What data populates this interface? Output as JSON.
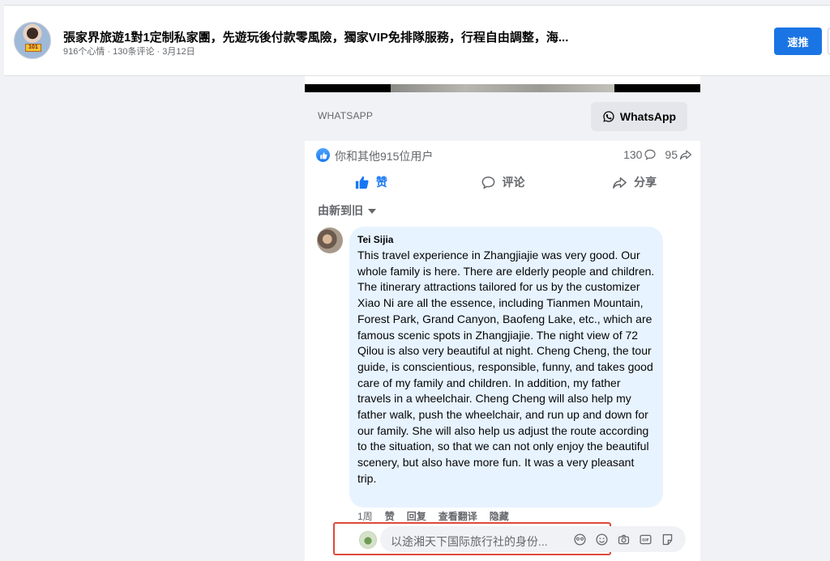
{
  "header": {
    "title": "張家界旅遊1對1定制私家團，先遊玩後付款零風險，獨家VIP免排隊服務，行程自由調整，海...",
    "meta": "916个心情 · 130条评论 · 3月12日",
    "boost_label": "速推",
    "avatar_sign": "101"
  },
  "link_preview": {
    "domain": "WHATSAPP",
    "cta_label": "WhatsApp"
  },
  "reactions": {
    "text": "你和其他915位用户",
    "comment_count": "130",
    "share_count": "95"
  },
  "actions": {
    "like": "赞",
    "comment": "评论",
    "share": "分享"
  },
  "sort": {
    "label": "由新到旧"
  },
  "comment": {
    "author": "Tei Sijia",
    "text": "This travel experience in Zhangjiajie was very good. Our whole family is here. There are elderly people and children. The itinerary attractions tailored for us by the customizer Xiao Ni are all the essence, including Tianmen Mountain, Forest Park, Grand Canyon, Baofeng Lake, etc., which are famous scenic spots in Zhangjiajie. The night view of 72 Qilou is also very beautiful at night. Cheng Cheng, the tour guide, is conscientious, responsible, funny, and takes good care of my family and children. In addition, my father travels in a wheelchair. Cheng Cheng will also help my father walk, push the wheelchair, and run up and down for our family. She will also help us adjust the route according to the situation, so that we can not only enjoy the beautiful scenery, but also have more fun. It was a very pleasant trip.",
    "time": "1周",
    "like": "赞",
    "reply": "回复",
    "translate": "查看翻译",
    "hide": "隐藏"
  },
  "reply_box": {
    "placeholder": "以途湘天下国际旅行社的身份..."
  },
  "colors": {
    "primary": "#1877f2",
    "highlight_border": "#e0493b",
    "bubble": "#e7f3ff"
  }
}
